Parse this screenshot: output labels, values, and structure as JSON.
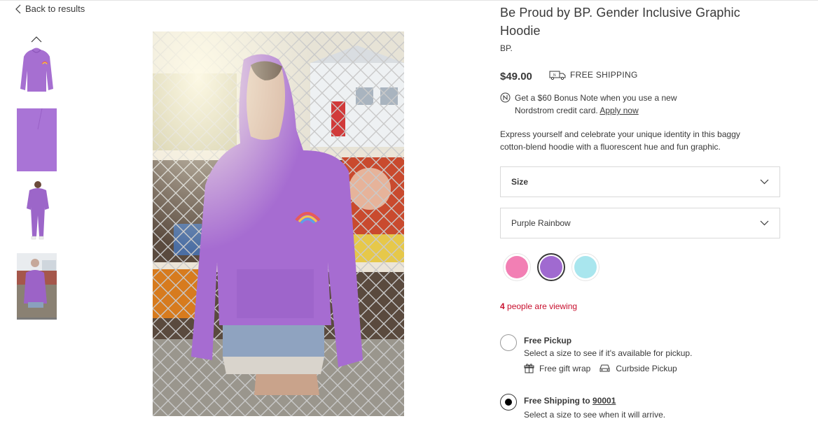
{
  "nav": {
    "back_label": "Back to results"
  },
  "product": {
    "title": "Be Proud by BP. Gender Inclusive Graphic Hoodie",
    "brand": "BP.",
    "price": "$49.00",
    "shipping_label": "FREE SHIPPING",
    "bonus_text": "Get a $60 Bonus Note when you use a new Nordstrom credit card.",
    "bonus_link": "Apply now",
    "description": "Express yourself and celebrate your unique identity in this baggy cotton-blend hoodie with a fluorescent hue and fun graphic."
  },
  "selectors": {
    "size_label": "Size",
    "color_value": "Purple Rainbow"
  },
  "swatches": [
    {
      "name": "pink",
      "color": "#f27fb4"
    },
    {
      "name": "purple",
      "color": "#a06ad0",
      "selected": true
    },
    {
      "name": "aqua",
      "color": "#a9e6ee"
    }
  ],
  "viewing": {
    "count": "4",
    "text": "people are viewing"
  },
  "fulfillment": {
    "pickup": {
      "title": "Free Pickup",
      "subtitle": "Select a size to see if it's available for pickup.",
      "perks": [
        "Free gift wrap",
        "Curbside Pickup"
      ]
    },
    "shipping": {
      "title_prefix": "Free Shipping to",
      "zip": "90001",
      "subtitle": "Select a size to see when it will arrive."
    }
  },
  "colors": {
    "accent_red": "#c8102e",
    "hoodie_purple": "#a06ad0"
  }
}
